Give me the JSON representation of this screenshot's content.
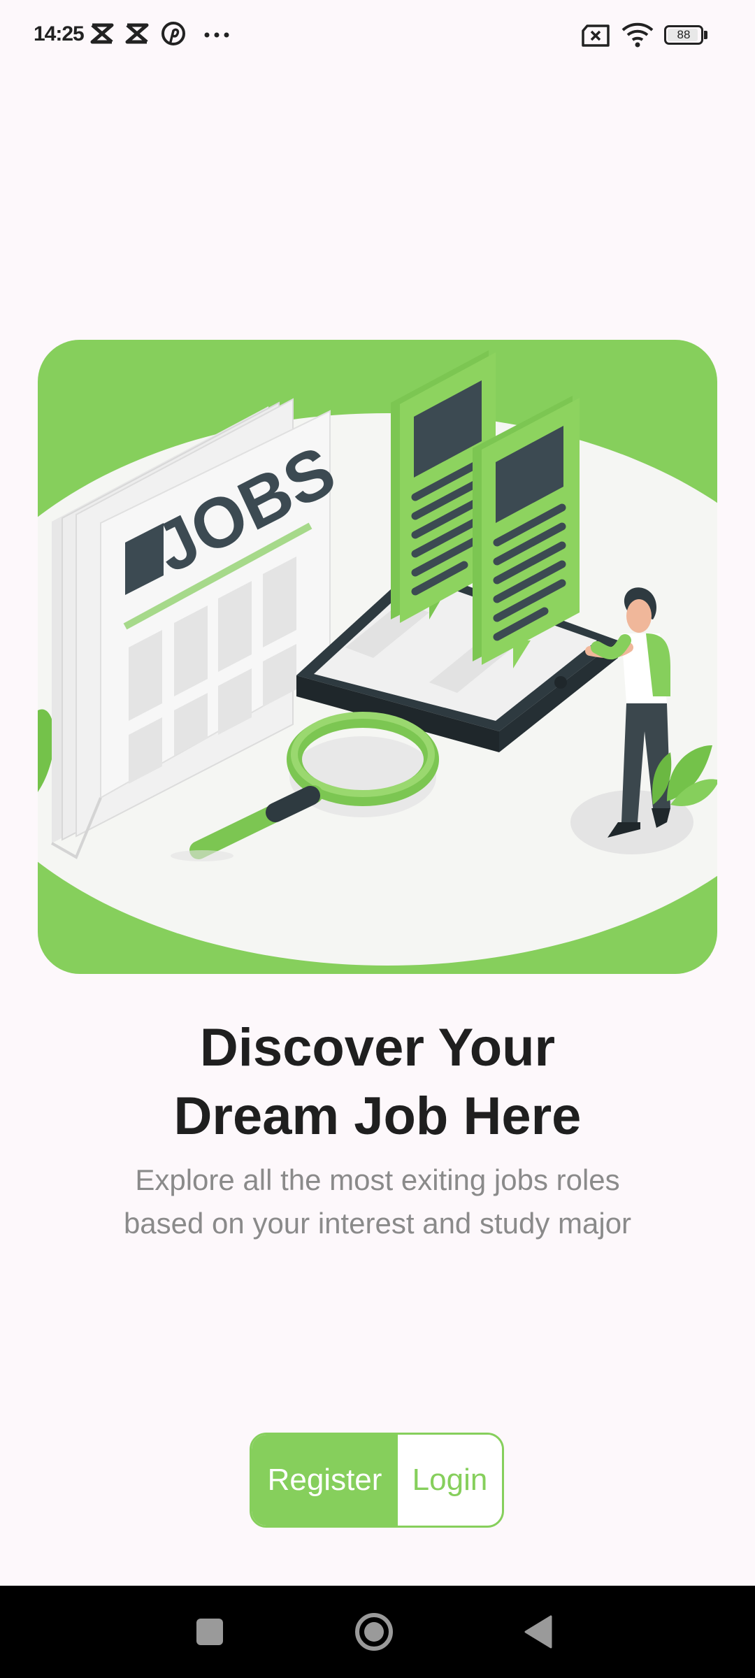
{
  "status_bar": {
    "time": "14:25",
    "battery_level": "88",
    "left_icons": [
      "capcut-icon",
      "capcut-icon",
      "pinterest-icon",
      "more-dots-icon"
    ],
    "right_icons": [
      "no-sim-icon",
      "wifi-icon",
      "battery-icon"
    ]
  },
  "hero": {
    "illustration": "jobs-newspaper-illustration",
    "newspaper_title": "JOBS",
    "background_color": "#86cf5c"
  },
  "onboarding": {
    "title_line1": "Discover Your",
    "title_line2": "Dream Job Here",
    "subtitle_line1": "Explore all the most exiting jobs roles",
    "subtitle_line2": "based on your interest and study major"
  },
  "actions": {
    "register_label": "Register",
    "login_label": "Login",
    "accent_color": "#86cf5c"
  },
  "nav_bar": {
    "buttons": [
      "recents-square-icon",
      "home-circle-icon",
      "back-triangle-icon"
    ]
  }
}
